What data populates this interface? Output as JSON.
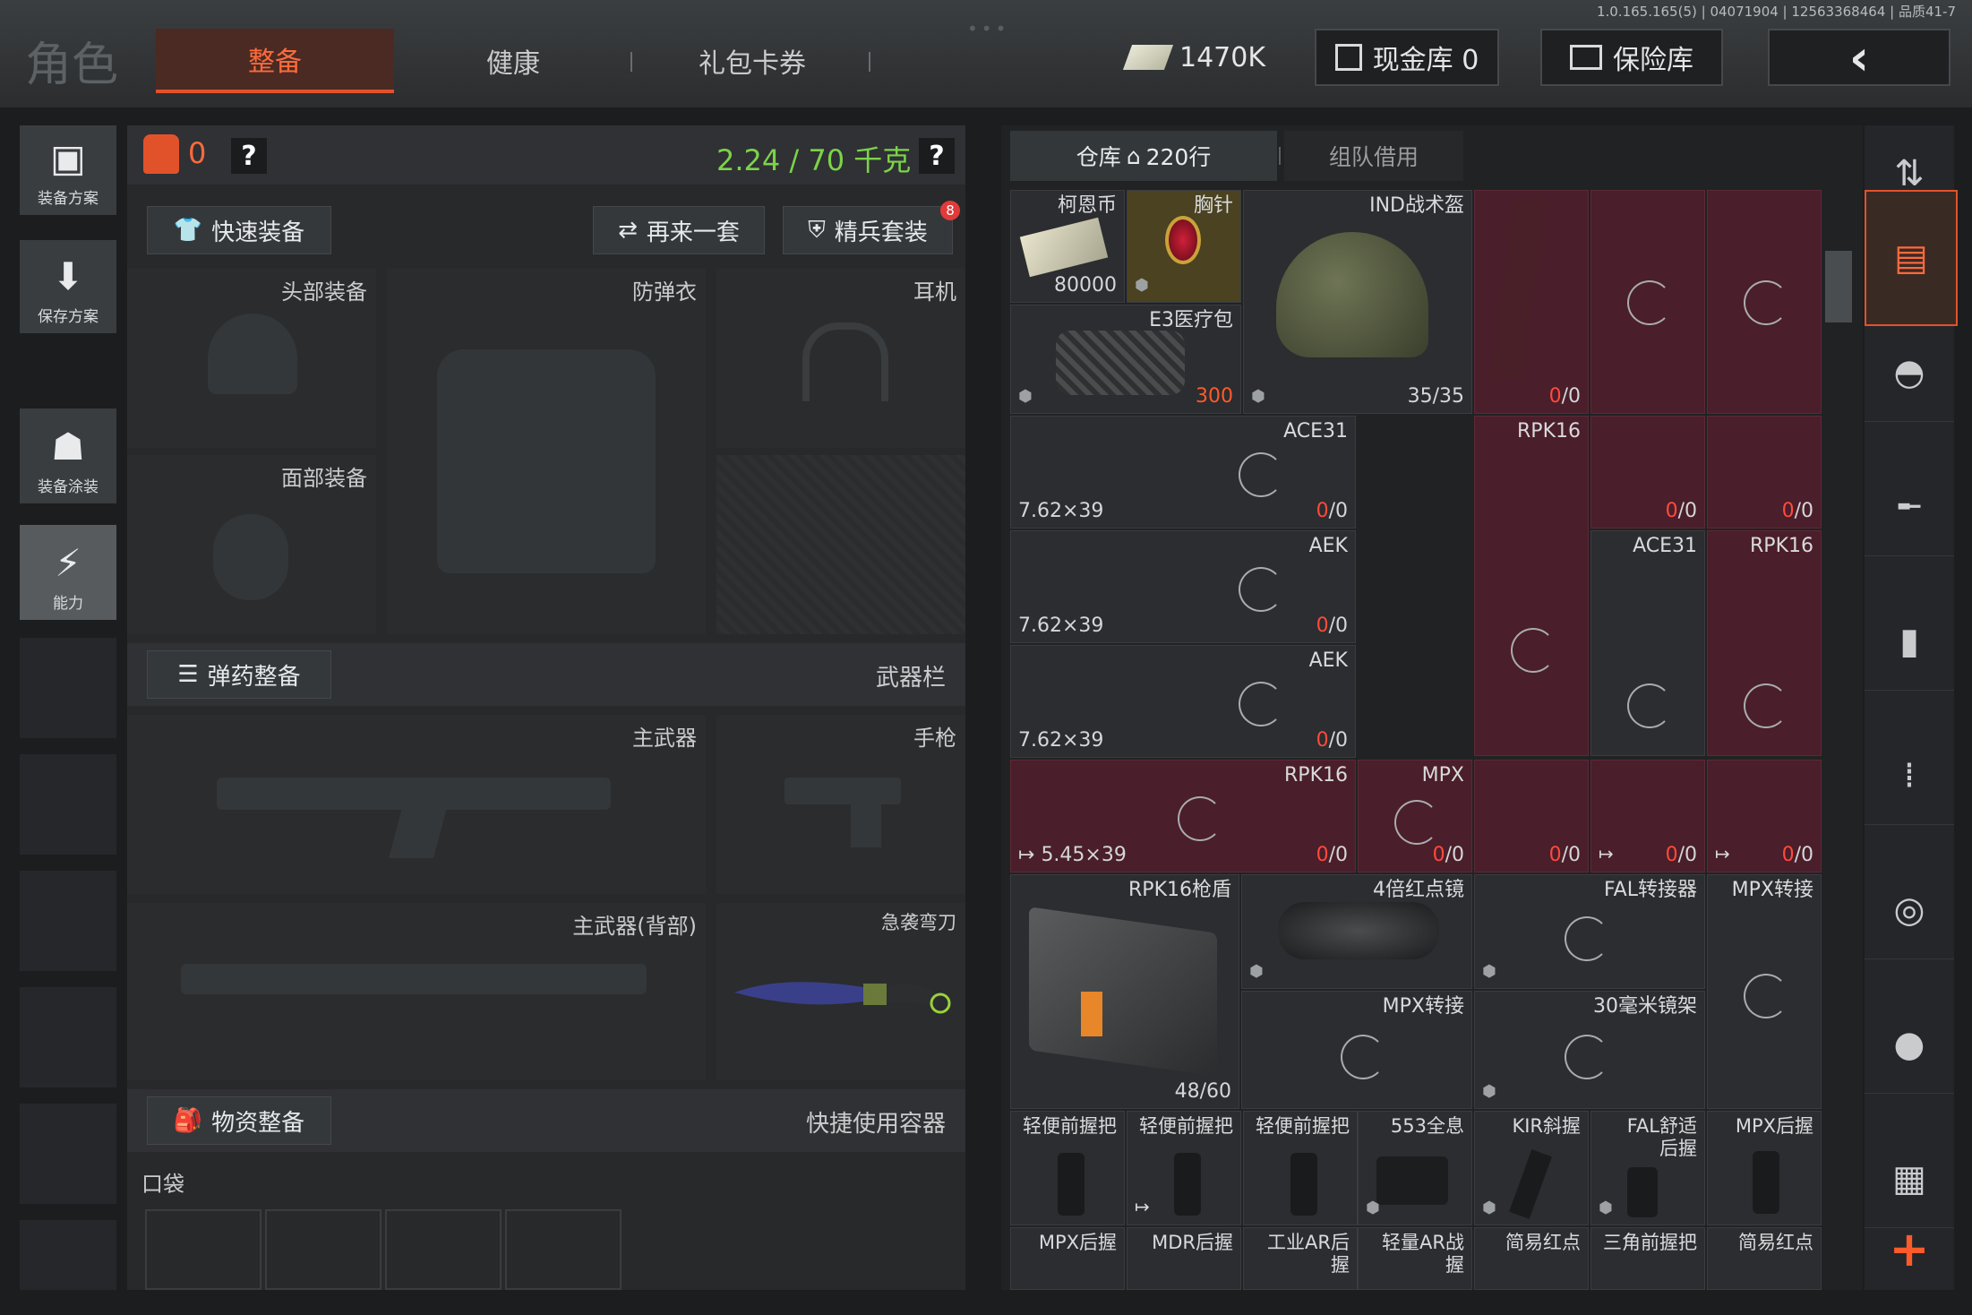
{
  "header": {
    "title": "角色",
    "tabs": [
      {
        "label": "整备",
        "active": true
      },
      {
        "label": "健康"
      },
      {
        "label": "礼包卡券"
      }
    ],
    "currency": "1470K",
    "cash_vault": "现金库 0",
    "safe": "保险库",
    "version": "1.0.165.165(5) | 04071904 | 12563368464 | 品质41-7",
    "back_icon": "chevron-left-icon"
  },
  "left_rail": [
    {
      "label": "装备方案",
      "icon": "vest-icon"
    },
    {
      "label": "保存方案",
      "icon": "download-icon"
    },
    {
      "label": "装备涂装",
      "icon": "paint-icon"
    },
    {
      "label": "能力",
      "icon": "lightning-icon"
    }
  ],
  "loadout": {
    "backpack_count": "0",
    "help": "?",
    "weight": "2.24 / 70 千克",
    "quick_equip": "快速装备",
    "again": "再来一套",
    "elite": "精兵套装",
    "elite_badge": "8",
    "slots": {
      "head": "头部装备",
      "armor": "防弹衣",
      "ear": "耳机",
      "face": "面部装备"
    },
    "ammo_section": "弹药整备",
    "weapon_bar": "武器栏",
    "weapons": {
      "primary": "主武器",
      "pistol": "手枪",
      "primary_back": "主武器(背部)",
      "knife": "急袭弯刀"
    },
    "supply_section": "物资整备",
    "quick_container": "快捷使用容器",
    "pocket": "口袋"
  },
  "warehouse": {
    "tab_active": "仓库",
    "tab_rows": "220行",
    "tab_team": "组队借用",
    "items": [
      {
        "name": "柯恩币",
        "count": "80000"
      },
      {
        "name": "胸针"
      },
      {
        "name": "IND战术盔",
        "count": "35/35"
      },
      {
        "name": "E3医疗包",
        "count": "300"
      },
      {
        "count": "0/0",
        "count_red": "0"
      },
      {
        "name": "ACE31",
        "ammo": "7.62×39",
        "count": "/0",
        "count_red": "0"
      },
      {
        "name": "RPK16"
      },
      {
        "count": "/0",
        "count_red": "0"
      },
      {
        "count": "/0",
        "count_red": "0"
      },
      {
        "name": "AEK",
        "ammo": "7.62×39",
        "count": "/0",
        "count_red": "0"
      },
      {
        "name": "ACE31"
      },
      {
        "name": "RPK16"
      },
      {
        "name": "AEK",
        "ammo": "7.62×39",
        "count": "/0",
        "count_red": "0"
      },
      {
        "name": "RPK16",
        "ammo": "5.45×39",
        "count": "/0",
        "count_red": "0"
      },
      {
        "name": "MPX",
        "count": "/0",
        "count_red": "0"
      },
      {
        "count": "/0",
        "count_red": "0"
      },
      {
        "count": "/0",
        "count_red": "0"
      },
      {
        "count": "/0",
        "count_red": "0"
      },
      {
        "name": "RPK16枪盾",
        "count": "48/60"
      },
      {
        "name": "4倍红点镜"
      },
      {
        "name": "FAL转接器"
      },
      {
        "name": "MPX转接"
      },
      {
        "name": "MPX转接"
      },
      {
        "name": "30毫米镜架"
      },
      {
        "name": "轻便前握把"
      },
      {
        "name": "轻便前握把"
      },
      {
        "name": "轻便前握把"
      },
      {
        "name": "553全息"
      },
      {
        "name": "KIR斜握"
      },
      {
        "name": "FAL舒适后握"
      },
      {
        "name": "MPX后握"
      },
      {
        "name": "MPX后握"
      },
      {
        "name": "MDR后握"
      },
      {
        "name": "工业AR后握"
      },
      {
        "name": "轻量AR战握"
      },
      {
        "name": "简易红点"
      },
      {
        "name": "三角前握把"
      },
      {
        "name": "简易红点"
      }
    ]
  },
  "right_rail": [
    "sort-icon",
    "stash-icon",
    "helmet-icon",
    "rifle-icon",
    "magazine-icon",
    "ammo-icon",
    "scope-icon",
    "grenade-icon",
    "misc-icon",
    "add-icon"
  ],
  "colors": {
    "accent": "#e2522a",
    "red_cell": "#4a1e2a",
    "weight": "#7cd34a"
  }
}
